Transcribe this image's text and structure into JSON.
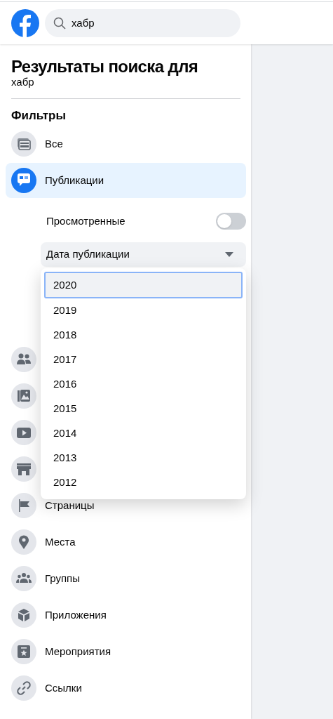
{
  "header": {
    "search": {
      "value": "хабр"
    }
  },
  "sidebar": {
    "title": "Результаты поиска для",
    "query": "хабр",
    "filters_heading": "Фильтры",
    "items": [
      {
        "label": "Все",
        "selected": false
      },
      {
        "label": "Публикации",
        "selected": true
      },
      {
        "selected": false
      },
      {
        "selected": false
      },
      {
        "selected": false
      },
      {
        "selected": false
      },
      {
        "label": "Страницы",
        "selected": false
      },
      {
        "label": "Места",
        "selected": false
      },
      {
        "label": "Группы",
        "selected": false
      },
      {
        "label": "Приложения",
        "selected": false
      },
      {
        "label": "Мероприятия",
        "selected": false
      },
      {
        "label": "Ссылки",
        "selected": false
      }
    ],
    "subfilters": {
      "toggle": {
        "label": "Просмотренные",
        "on": false
      },
      "dropdown": {
        "label": "Дата публикации",
        "expanded": true,
        "options": [
          {
            "label": "2020",
            "selected": true
          },
          {
            "label": "2019",
            "selected": false
          },
          {
            "label": "2018",
            "selected": false
          },
          {
            "label": "2017",
            "selected": false
          },
          {
            "label": "2016",
            "selected": false
          },
          {
            "label": "2015",
            "selected": false
          },
          {
            "label": "2014",
            "selected": false
          },
          {
            "label": "2013",
            "selected": false
          },
          {
            "label": "2012",
            "selected": false
          }
        ]
      }
    }
  }
}
